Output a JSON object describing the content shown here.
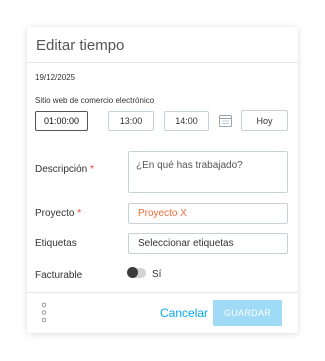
{
  "dialog": {
    "title": "Editar tiempo",
    "date": "19/12/2025",
    "project_line": "Sitio web de comercio electrónico",
    "duration": "01:00:00",
    "start_time": "13:00",
    "end_time": "14:00",
    "today_label": "Hoy",
    "description": {
      "label": "Descripción",
      "required_mark": "*",
      "placeholder": "¿En qué has trabajado?"
    },
    "project": {
      "label": "Proyecto",
      "required_mark": "*",
      "value": "Proyecto X"
    },
    "tags": {
      "label": "Etiquetas",
      "value": "Seleccionar etiquetas"
    },
    "billable": {
      "label": "Facturable",
      "value_label": "Sí",
      "on": false
    },
    "footer": {
      "cancel_label": "Cancelar",
      "save_label": "GUARDAR"
    }
  },
  "colors": {
    "accent": "#03a9f4",
    "save_disabled": "#9fdaf6",
    "required": "#f44336",
    "project": "#f26b3a",
    "border": "#c6d2d9"
  },
  "icons": [
    "calendar-icon",
    "more-vertical-icon"
  ]
}
